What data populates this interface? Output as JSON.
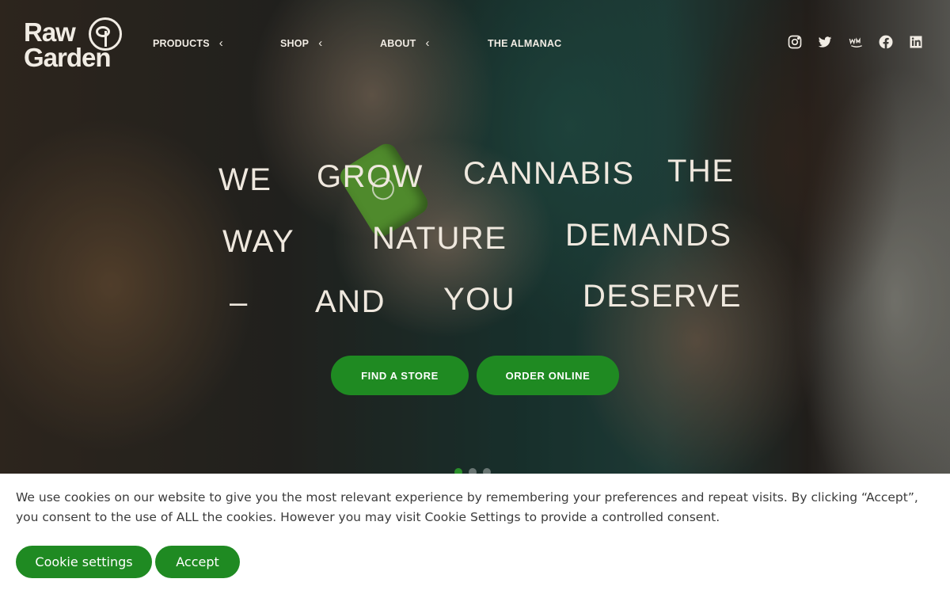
{
  "brand": {
    "logo_line1": "Raw",
    "logo_line2": "Garden"
  },
  "nav": {
    "products": "PRODUCTS",
    "shop": "SHOP",
    "about": "ABOUT",
    "almanac": "THE ALMANAC"
  },
  "social": [
    "instagram-icon",
    "twitter-icon",
    "weedmaps-icon",
    "facebook-icon",
    "linkedin-icon"
  ],
  "hero": {
    "words": [
      "WE",
      "GROW",
      "CANNABIS",
      "THE",
      "WAY",
      "NATURE",
      "DEMANDS",
      "–",
      "AND",
      "YOU",
      "DESERVE"
    ],
    "find_store": "FIND A STORE",
    "order_online": "ORDER ONLINE"
  },
  "cookie": {
    "text": "We use cookies on our website to give you the most relevant experience by remembering your preferences and repeat visits. By clicking “Accept”, you consent to the use of ALL the cookies. However you may visit Cookie Settings to provide a controlled consent.",
    "settings_label": "Cookie settings",
    "accept_label": "Accept"
  },
  "colors": {
    "brand_green": "#1f8a22",
    "cream": "#f1ece4"
  }
}
